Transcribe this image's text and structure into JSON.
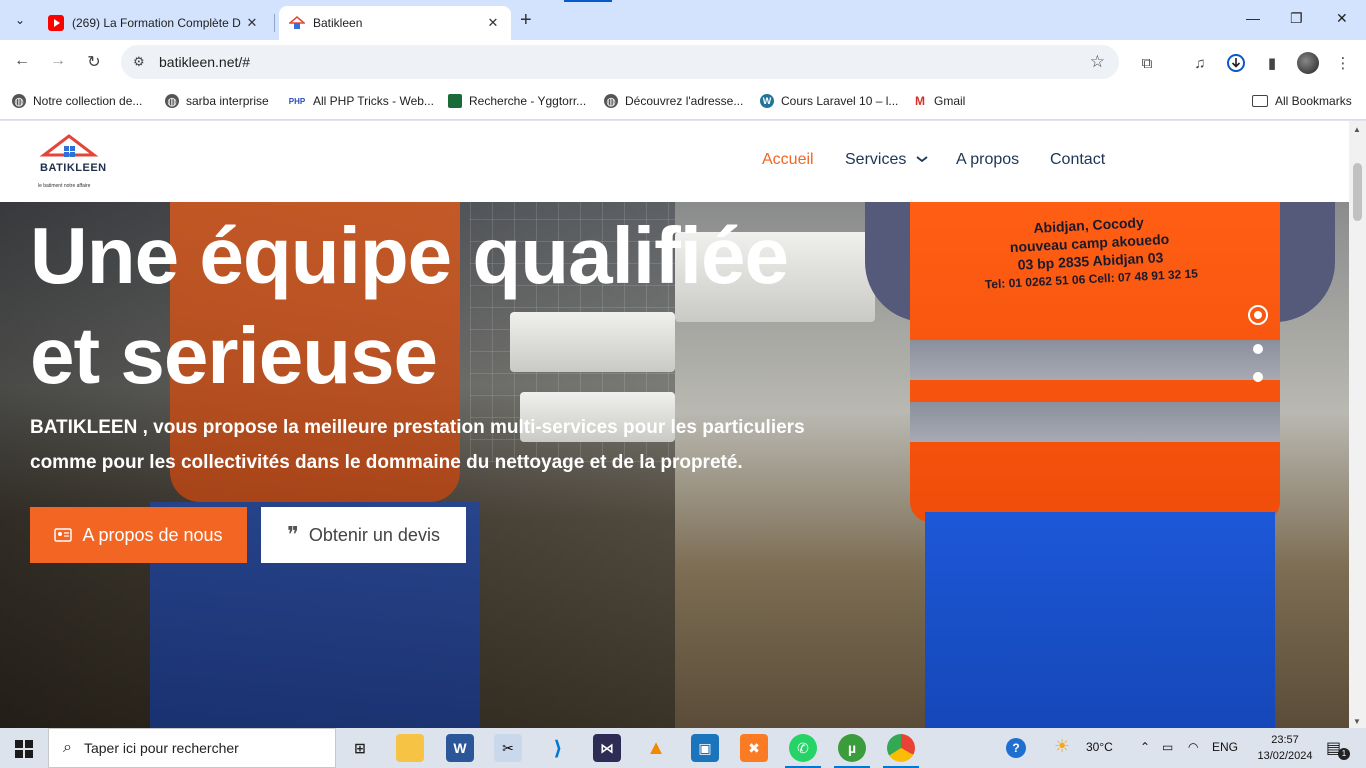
{
  "tabs": [
    {
      "title": "(269) La Formation Complète D",
      "favicon": "youtube-icon",
      "active": false
    },
    {
      "title": "Batikleen",
      "favicon": "batikleen-icon",
      "active": true
    }
  ],
  "address_bar": {
    "url": "batikleen.net/#"
  },
  "bookmarks": [
    {
      "label": "Notre collection de...",
      "icon": "globe-icon"
    },
    {
      "label": "sarba interprise",
      "icon": "globe-icon"
    },
    {
      "label": "All PHP Tricks - Web...",
      "icon": "php-icon"
    },
    {
      "label": "Recherche - Yggtorr...",
      "icon": "ygg-icon"
    },
    {
      "label": "Découvrez l'adresse...",
      "icon": "globe-icon"
    },
    {
      "label": "Cours Laravel 10 – l...",
      "icon": "wordpress-icon"
    },
    {
      "label": "Gmail",
      "icon": "gmail-icon"
    }
  ],
  "bookmarks_folder": "All Bookmarks",
  "site": {
    "logo_text": "BATIKLEEN",
    "logo_tagline": "le batiment notre affaire",
    "nav": [
      {
        "label": "Accueil",
        "active": true
      },
      {
        "label": "Services",
        "has_dropdown": true
      },
      {
        "label": "A propos"
      },
      {
        "label": "Contact"
      }
    ],
    "hero": {
      "title_line1": "Une équipe qualifiée",
      "title_line2": "et serieuse",
      "subtitle_line1": "BATIKLEEN , vous propose la meilleure prestation multi-services pour les particuliers",
      "subtitle_line2": "comme pour les collectivités dans le dommaine du nettoyage et de la propreté.",
      "primary_button": "A propos de nous",
      "secondary_button": "Obtenir un devis",
      "vest_text": [
        "Abidjan, Cocody",
        "nouveau camp akouedo",
        "03 bp 2835 Abidjan 03",
        "Tel: 01 0262 51 06 Cell: 07 48 91 32 15"
      ],
      "slides": 3,
      "active_slide": 1
    },
    "colors": {
      "accent": "#f26522",
      "nav": "#1d3557"
    }
  },
  "taskbar": {
    "search_placeholder": "Taper ici pour rechercher",
    "apps": [
      "task-view",
      "file-explorer",
      "word",
      "snipping",
      "vscode",
      "visual-studio",
      "vlc",
      "virtualbox",
      "xampp",
      "whatsapp",
      "utorrent",
      "chrome"
    ],
    "weather": "30°C",
    "language": "ENG",
    "time": "23:57",
    "date": "13/02/2024",
    "notifications": "1"
  }
}
